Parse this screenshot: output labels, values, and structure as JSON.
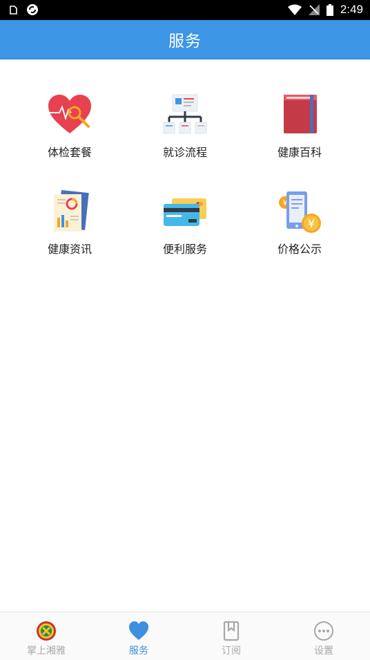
{
  "status_bar": {
    "time": "2:49"
  },
  "header": {
    "title": "服务"
  },
  "services": [
    {
      "label": "体检套餐",
      "icon": "heart-search-icon"
    },
    {
      "label": "就诊流程",
      "icon": "flowchart-icon"
    },
    {
      "label": "健康百科",
      "icon": "book-icon"
    },
    {
      "label": "健康资讯",
      "icon": "report-icon"
    },
    {
      "label": "便利服务",
      "icon": "credit-card-icon"
    },
    {
      "label": "价格公示",
      "icon": "phone-yuan-icon"
    }
  ],
  "tabbar": {
    "active": "服务",
    "tabs": [
      {
        "label": "掌上湘雅",
        "icon": "hospital-logo-icon"
      },
      {
        "label": "服务",
        "icon": "heart-icon"
      },
      {
        "label": "订阅",
        "icon": "bookmark-icon"
      },
      {
        "label": "设置",
        "icon": "more-icon"
      }
    ]
  },
  "colors": {
    "header": "#3d95e6",
    "active_tab": "#3d8fe0",
    "inactive_tab": "#a8a8a8"
  }
}
